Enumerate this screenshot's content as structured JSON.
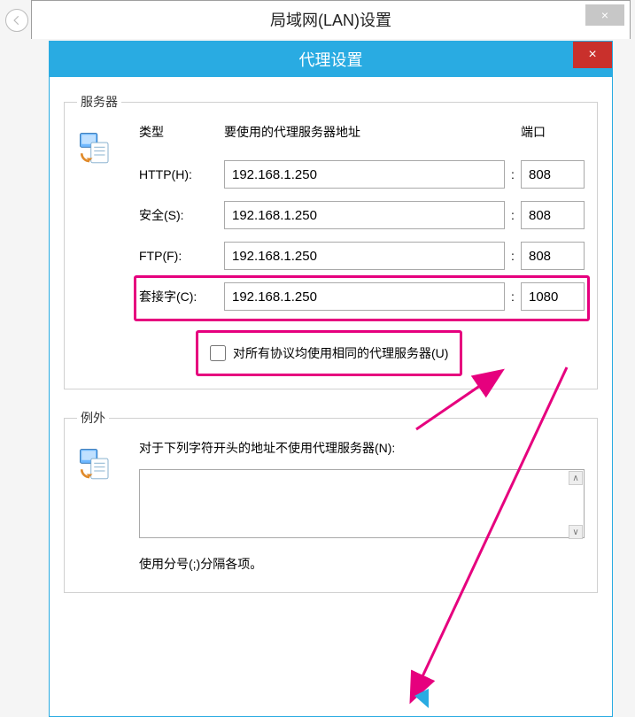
{
  "outer": {
    "title": "局域网(LAN)设置",
    "close": "×"
  },
  "inner": {
    "title": "代理设置",
    "close": "×"
  },
  "server_group": {
    "legend": "服务器",
    "headers": {
      "type": "类型",
      "address": "要使用的代理服务器地址",
      "port": "端口"
    },
    "rows": {
      "http": {
        "label": "HTTP(H):",
        "address": "192.168.1.250",
        "port": "808"
      },
      "secure": {
        "label": "安全(S):",
        "address": "192.168.1.250",
        "port": "808"
      },
      "ftp": {
        "label": "FTP(F):",
        "address": "192.168.1.250",
        "port": "808"
      },
      "socks": {
        "label": "套接字(C):",
        "address": "192.168.1.250",
        "port": "1080"
      }
    },
    "same_proxy_checkbox": "对所有协议均使用相同的代理服务器(U)"
  },
  "exceptions_group": {
    "legend": "例外",
    "label": "对于下列字符开头的地址不使用代理服务器(N):",
    "value": "",
    "note": "使用分号(;)分隔各项。"
  },
  "colon": ":"
}
